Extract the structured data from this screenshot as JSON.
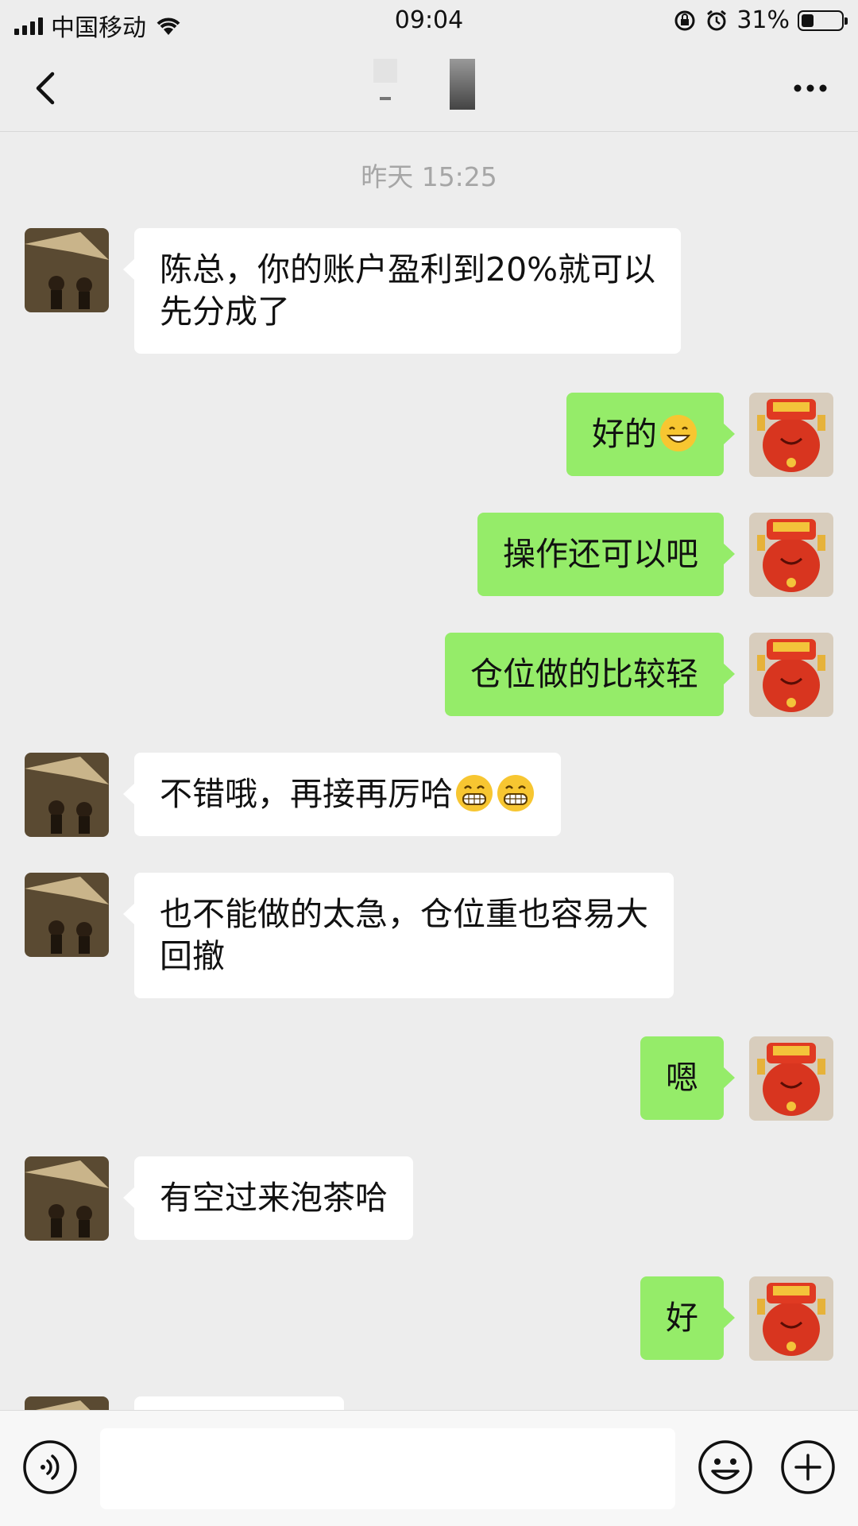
{
  "status_bar": {
    "carrier": "中国移动",
    "time": "09:04",
    "battery_percent": "31%",
    "battery_level": 0.31
  },
  "chat": {
    "timestamp": "昨天 15:25",
    "messages": [
      {
        "side": "left",
        "text": "陈总，你的账户盈利到20%就可以\n先分成了"
      },
      {
        "side": "right",
        "text": "好的",
        "emoji": "grin-emoji"
      },
      {
        "side": "right",
        "text": "操作还可以吧"
      },
      {
        "side": "right",
        "text": "仓位做的比较轻"
      },
      {
        "side": "left",
        "text": "不错哦，再接再厉哈",
        "emoji": "big-grin-emoji-x2"
      },
      {
        "side": "left",
        "text": "也不能做的太急，仓位重也容易大\n回撤"
      },
      {
        "side": "right",
        "text": "嗯"
      },
      {
        "side": "left",
        "text": "有空过来泡茶哈"
      },
      {
        "side": "right",
        "text": "好"
      }
    ]
  },
  "input_bar": {
    "placeholder": ""
  },
  "colors": {
    "background": "#EDEDED",
    "bubble_self": "#95EC69",
    "bubble_other": "#FFFFFF",
    "timestamp": "#A6A6A6"
  },
  "icons": [
    "back-arrow-icon",
    "more-dots-icon",
    "voice-icon",
    "emoji-face-icon",
    "plus-icon",
    "wifi-icon",
    "alarm-icon",
    "rotation-lock-icon"
  ]
}
